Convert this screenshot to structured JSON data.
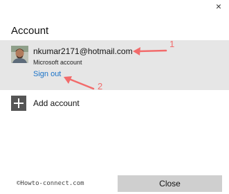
{
  "window": {
    "close_glyph": "×",
    "title": "Account"
  },
  "account": {
    "email": "nkumar2171@hotmail.com",
    "account_type": "Microsoft account",
    "sign_out_label": "Sign out",
    "link_color": "#1a73c8",
    "panel_color": "#e6e6e6"
  },
  "annotations": {
    "label_1": "1",
    "label_2": "2",
    "color": "#f26b6b"
  },
  "add_account": {
    "icon": "plus-icon",
    "label": "Add account"
  },
  "footer": {
    "watermark": "©Howto-connect.com",
    "close_label": "Close"
  }
}
